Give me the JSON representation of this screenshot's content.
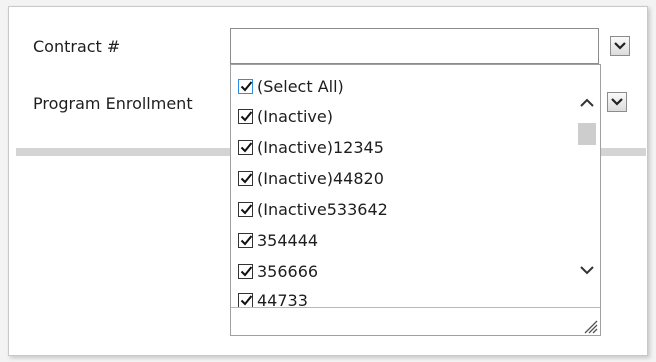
{
  "form": {
    "contract_label": "Contract #",
    "program_label": "Program Enrollment",
    "contract_value": ""
  },
  "dropdown": {
    "items": [
      {
        "label": "(Select All)",
        "checked": true
      },
      {
        "label": "(Inactive)",
        "checked": true
      },
      {
        "label": "(Inactive)12345",
        "checked": true
      },
      {
        "label": "(Inactive)44820",
        "checked": true
      },
      {
        "label": "(Inactive533642",
        "checked": true
      },
      {
        "label": "354444",
        "checked": true
      },
      {
        "label": "356666",
        "checked": true
      },
      {
        "label": "44733",
        "checked": true
      }
    ]
  },
  "colors": {
    "focus_border": "#2c8ee6",
    "scroll_thumb": "#cdcdcd"
  }
}
